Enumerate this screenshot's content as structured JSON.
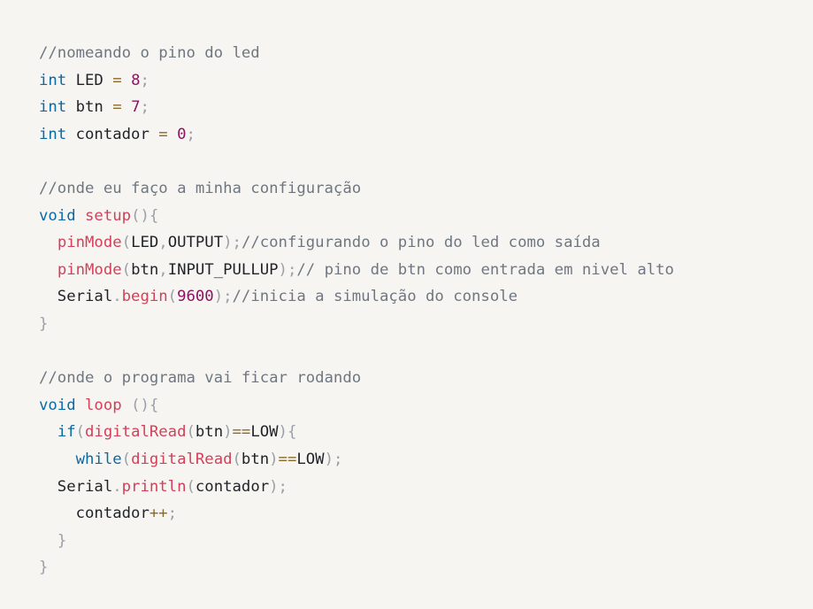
{
  "code_block": {
    "language": "arduino-cpp",
    "colors": {
      "background": "#f7f5f2",
      "comment": "#6e7781",
      "keyword": "#0a6aa3",
      "function": "#d2405a",
      "number": "#8a1560",
      "punctuation": "#9aa0a6",
      "operator": "#8a6a2a",
      "text": "#1f2328"
    },
    "lines": [
      [
        {
          "t": "comment",
          "v": "//nomeando o pino do led"
        }
      ],
      [
        {
          "t": "keyword",
          "v": "int"
        },
        {
          "t": "plain",
          "v": " LED "
        },
        {
          "t": "operator",
          "v": "="
        },
        {
          "t": "plain",
          "v": " "
        },
        {
          "t": "number",
          "v": "8"
        },
        {
          "t": "punct",
          "v": ";"
        }
      ],
      [
        {
          "t": "keyword",
          "v": "int"
        },
        {
          "t": "plain",
          "v": " btn "
        },
        {
          "t": "operator",
          "v": "="
        },
        {
          "t": "plain",
          "v": " "
        },
        {
          "t": "number",
          "v": "7"
        },
        {
          "t": "punct",
          "v": ";"
        }
      ],
      [
        {
          "t": "keyword",
          "v": "int"
        },
        {
          "t": "plain",
          "v": " contador "
        },
        {
          "t": "operator",
          "v": "="
        },
        {
          "t": "plain",
          "v": " "
        },
        {
          "t": "number",
          "v": "0"
        },
        {
          "t": "punct",
          "v": ";"
        }
      ],
      [],
      [
        {
          "t": "comment",
          "v": "//onde eu faço a minha configuração"
        }
      ],
      [
        {
          "t": "keyword",
          "v": "void"
        },
        {
          "t": "plain",
          "v": " "
        },
        {
          "t": "function",
          "v": "setup"
        },
        {
          "t": "punct",
          "v": "(){"
        }
      ],
      [
        {
          "t": "plain",
          "v": "  "
        },
        {
          "t": "function",
          "v": "pinMode"
        },
        {
          "t": "punct",
          "v": "("
        },
        {
          "t": "plain",
          "v": "LED"
        },
        {
          "t": "punct",
          "v": ","
        },
        {
          "t": "plain",
          "v": "OUTPUT"
        },
        {
          "t": "punct",
          "v": ");"
        },
        {
          "t": "comment",
          "v": "//configurando o pino do led como saída"
        }
      ],
      [
        {
          "t": "plain",
          "v": "  "
        },
        {
          "t": "function",
          "v": "pinMode"
        },
        {
          "t": "punct",
          "v": "("
        },
        {
          "t": "plain",
          "v": "btn"
        },
        {
          "t": "punct",
          "v": ","
        },
        {
          "t": "plain",
          "v": "INPUT_PULLUP"
        },
        {
          "t": "punct",
          "v": ");"
        },
        {
          "t": "comment",
          "v": "// pino de btn como entrada em nivel alto"
        }
      ],
      [
        {
          "t": "plain",
          "v": "  Serial"
        },
        {
          "t": "punct",
          "v": "."
        },
        {
          "t": "function",
          "v": "begin"
        },
        {
          "t": "punct",
          "v": "("
        },
        {
          "t": "number",
          "v": "9600"
        },
        {
          "t": "punct",
          "v": ");"
        },
        {
          "t": "comment",
          "v": "//inicia a simulação do console"
        }
      ],
      [
        {
          "t": "punct",
          "v": "}"
        }
      ],
      [],
      [
        {
          "t": "comment",
          "v": "//onde o programa vai ficar rodando"
        }
      ],
      [
        {
          "t": "keyword",
          "v": "void"
        },
        {
          "t": "plain",
          "v": " "
        },
        {
          "t": "function",
          "v": "loop"
        },
        {
          "t": "plain",
          "v": " "
        },
        {
          "t": "punct",
          "v": "(){"
        }
      ],
      [
        {
          "t": "plain",
          "v": "  "
        },
        {
          "t": "keyword",
          "v": "if"
        },
        {
          "t": "punct",
          "v": "("
        },
        {
          "t": "function",
          "v": "digitalRead"
        },
        {
          "t": "punct",
          "v": "("
        },
        {
          "t": "plain",
          "v": "btn"
        },
        {
          "t": "punct",
          "v": ")"
        },
        {
          "t": "operator",
          "v": "=="
        },
        {
          "t": "plain",
          "v": "LOW"
        },
        {
          "t": "punct",
          "v": "){"
        }
      ],
      [
        {
          "t": "plain",
          "v": "    "
        },
        {
          "t": "keyword",
          "v": "while"
        },
        {
          "t": "punct",
          "v": "("
        },
        {
          "t": "function",
          "v": "digitalRead"
        },
        {
          "t": "punct",
          "v": "("
        },
        {
          "t": "plain",
          "v": "btn"
        },
        {
          "t": "punct",
          "v": ")"
        },
        {
          "t": "operator",
          "v": "=="
        },
        {
          "t": "plain",
          "v": "LOW"
        },
        {
          "t": "punct",
          "v": ");"
        }
      ],
      [
        {
          "t": "plain",
          "v": "  Serial"
        },
        {
          "t": "punct",
          "v": "."
        },
        {
          "t": "function",
          "v": "println"
        },
        {
          "t": "punct",
          "v": "("
        },
        {
          "t": "plain",
          "v": "contador"
        },
        {
          "t": "punct",
          "v": ");"
        }
      ],
      [
        {
          "t": "plain",
          "v": "    contador"
        },
        {
          "t": "operator",
          "v": "++"
        },
        {
          "t": "punct",
          "v": ";"
        }
      ],
      [
        {
          "t": "plain",
          "v": "  "
        },
        {
          "t": "punct",
          "v": "}"
        }
      ],
      [
        {
          "t": "punct",
          "v": "}"
        }
      ]
    ]
  }
}
